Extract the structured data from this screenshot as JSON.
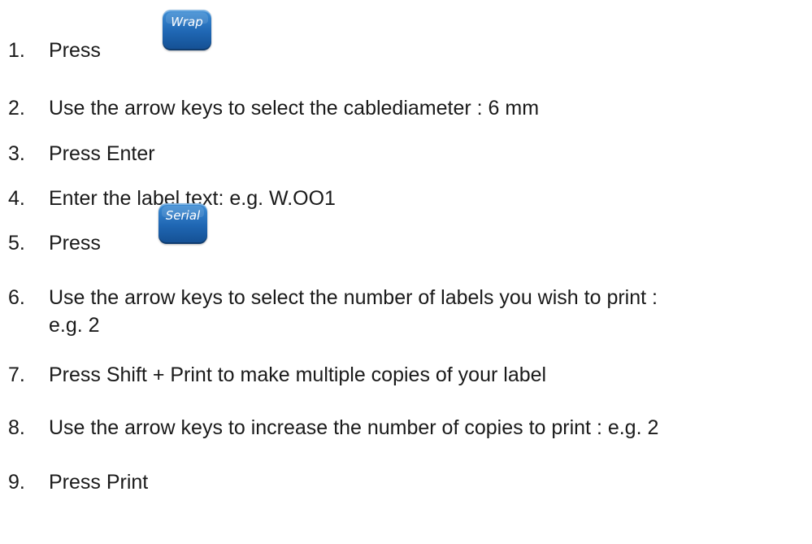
{
  "steps": [
    {
      "number": "1.",
      "text": "Press",
      "key": {
        "label": "Wrap",
        "icon": "wrap-key-icon"
      }
    },
    {
      "number": "2.",
      "text": "Use the arrow keys to select the cablediameter :  6 mm"
    },
    {
      "number": "3.",
      "text": "Press Enter"
    },
    {
      "number": "4.",
      "text": "Enter the label text: e.g. W.OO1"
    },
    {
      "number": "5.",
      "text": "Press",
      "key": {
        "label": "Serial",
        "icon": "serial-key-icon"
      }
    },
    {
      "number": "6.",
      "text": "Use the arrow keys to select the number of labels you wish to print :",
      "text_line2": "e.g. 2"
    },
    {
      "number": "7.",
      "text": "Press Shift + Print to make multiple copies of your label"
    },
    {
      "number": "8.",
      "text": "Use the arrow keys to increase the number of copies to print : e.g. 2"
    },
    {
      "number": "9.",
      "text": "Press Print"
    }
  ],
  "colors": {
    "key_blue": "#1f66b3",
    "text": "#1a1a1a"
  }
}
